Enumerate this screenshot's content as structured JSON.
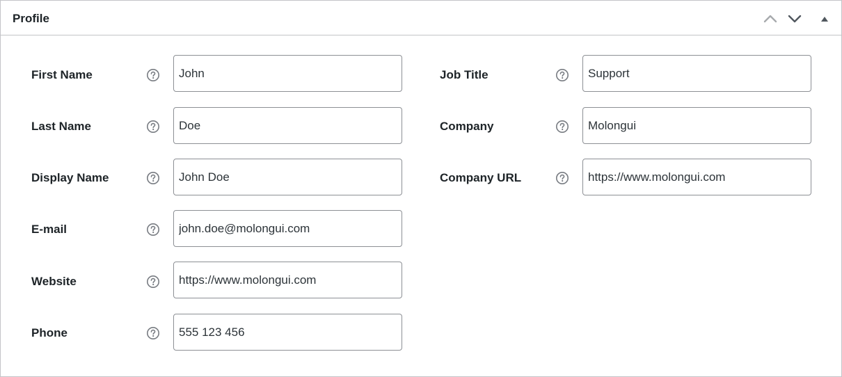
{
  "panel": {
    "title": "Profile"
  },
  "header_controls": {
    "move_up_icon": "chevron-up-icon",
    "move_down_icon": "chevron-down-icon",
    "toggle_icon": "triangle-up-icon"
  },
  "help_icon": "question-circle-icon",
  "colors": {
    "border": "#c3c4c7",
    "input_border": "#8c8f94",
    "text": "#1d2327",
    "icon": "#787c82"
  },
  "left_fields": [
    {
      "label": "First Name",
      "value": "John"
    },
    {
      "label": "Last Name",
      "value": "Doe"
    },
    {
      "label": "Display Name",
      "value": "John Doe"
    },
    {
      "label": "E-mail",
      "value": "john.doe@molongui.com"
    },
    {
      "label": "Website",
      "value": "https://www.molongui.com"
    },
    {
      "label": "Phone",
      "value": "555 123 456"
    }
  ],
  "right_fields": [
    {
      "label": "Job Title",
      "value": "Support"
    },
    {
      "label": "Company",
      "value": "Molongui"
    },
    {
      "label": "Company URL",
      "value": "https://www.molongui.com"
    }
  ]
}
